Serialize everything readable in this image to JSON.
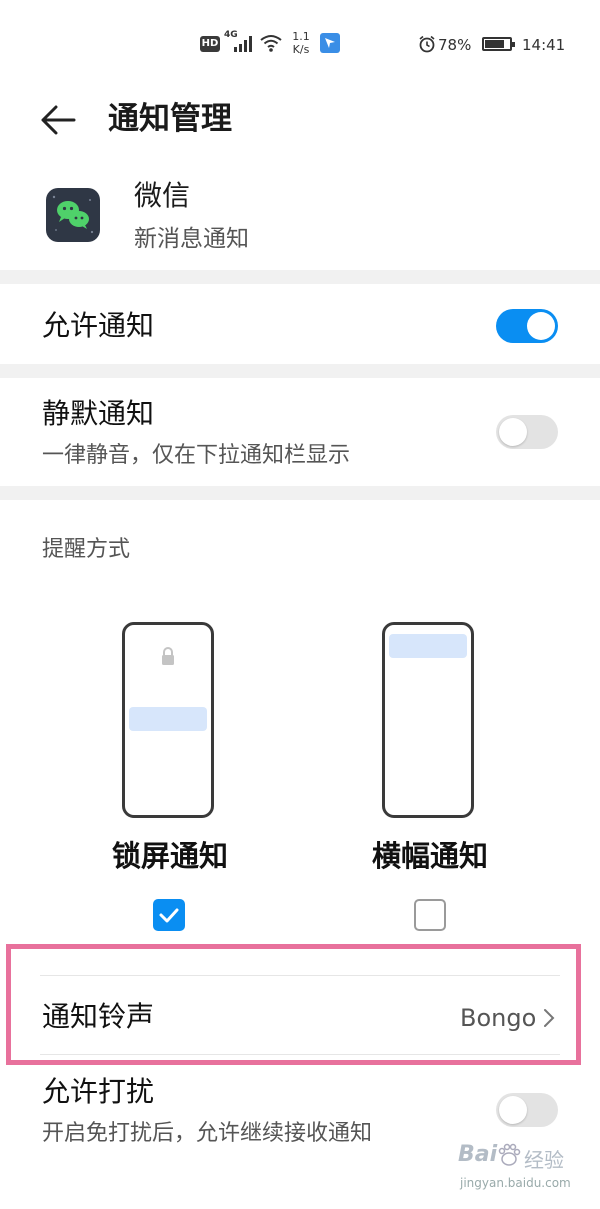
{
  "status_bar": {
    "hd": "HD",
    "network": "4G",
    "speed_value": "1.1",
    "speed_unit": "K/s",
    "battery": "78%",
    "time": "14:41",
    "battery_level": 0.78,
    "icons": [
      "hd-icon",
      "signal-icon",
      "wifi-icon",
      "app-notification-icon",
      "alarm-icon",
      "battery-icon"
    ]
  },
  "header": {
    "title": "通知管理",
    "back_icon": "arrow-left-icon"
  },
  "app": {
    "name": "微信",
    "subtitle": "新消息通知",
    "icon": "wechat-icon"
  },
  "settings": {
    "allow_notifications": {
      "label": "允许通知",
      "enabled": true
    },
    "silent_notifications": {
      "label": "静默通知",
      "description": "一律静音，仅在下拉通知栏显示",
      "enabled": false
    },
    "reminder_section": {
      "label": "提醒方式",
      "options": [
        {
          "label": "锁屏通知",
          "checked": true
        },
        {
          "label": "横幅通知",
          "checked": false
        }
      ]
    },
    "ringtone": {
      "label": "通知铃声",
      "value": "Bongo"
    },
    "allow_dnd": {
      "label": "允许打扰",
      "description": "开启免打扰后，允许继续接收通知",
      "enabled": false
    }
  },
  "watermark": {
    "brand": "Bai",
    "brand2": "经验",
    "url": "jingyan.baidu.com"
  },
  "colors": {
    "accent": "#0a8ef2",
    "highlight": "#e8719c",
    "banner_fill": "#d7e6fb"
  }
}
